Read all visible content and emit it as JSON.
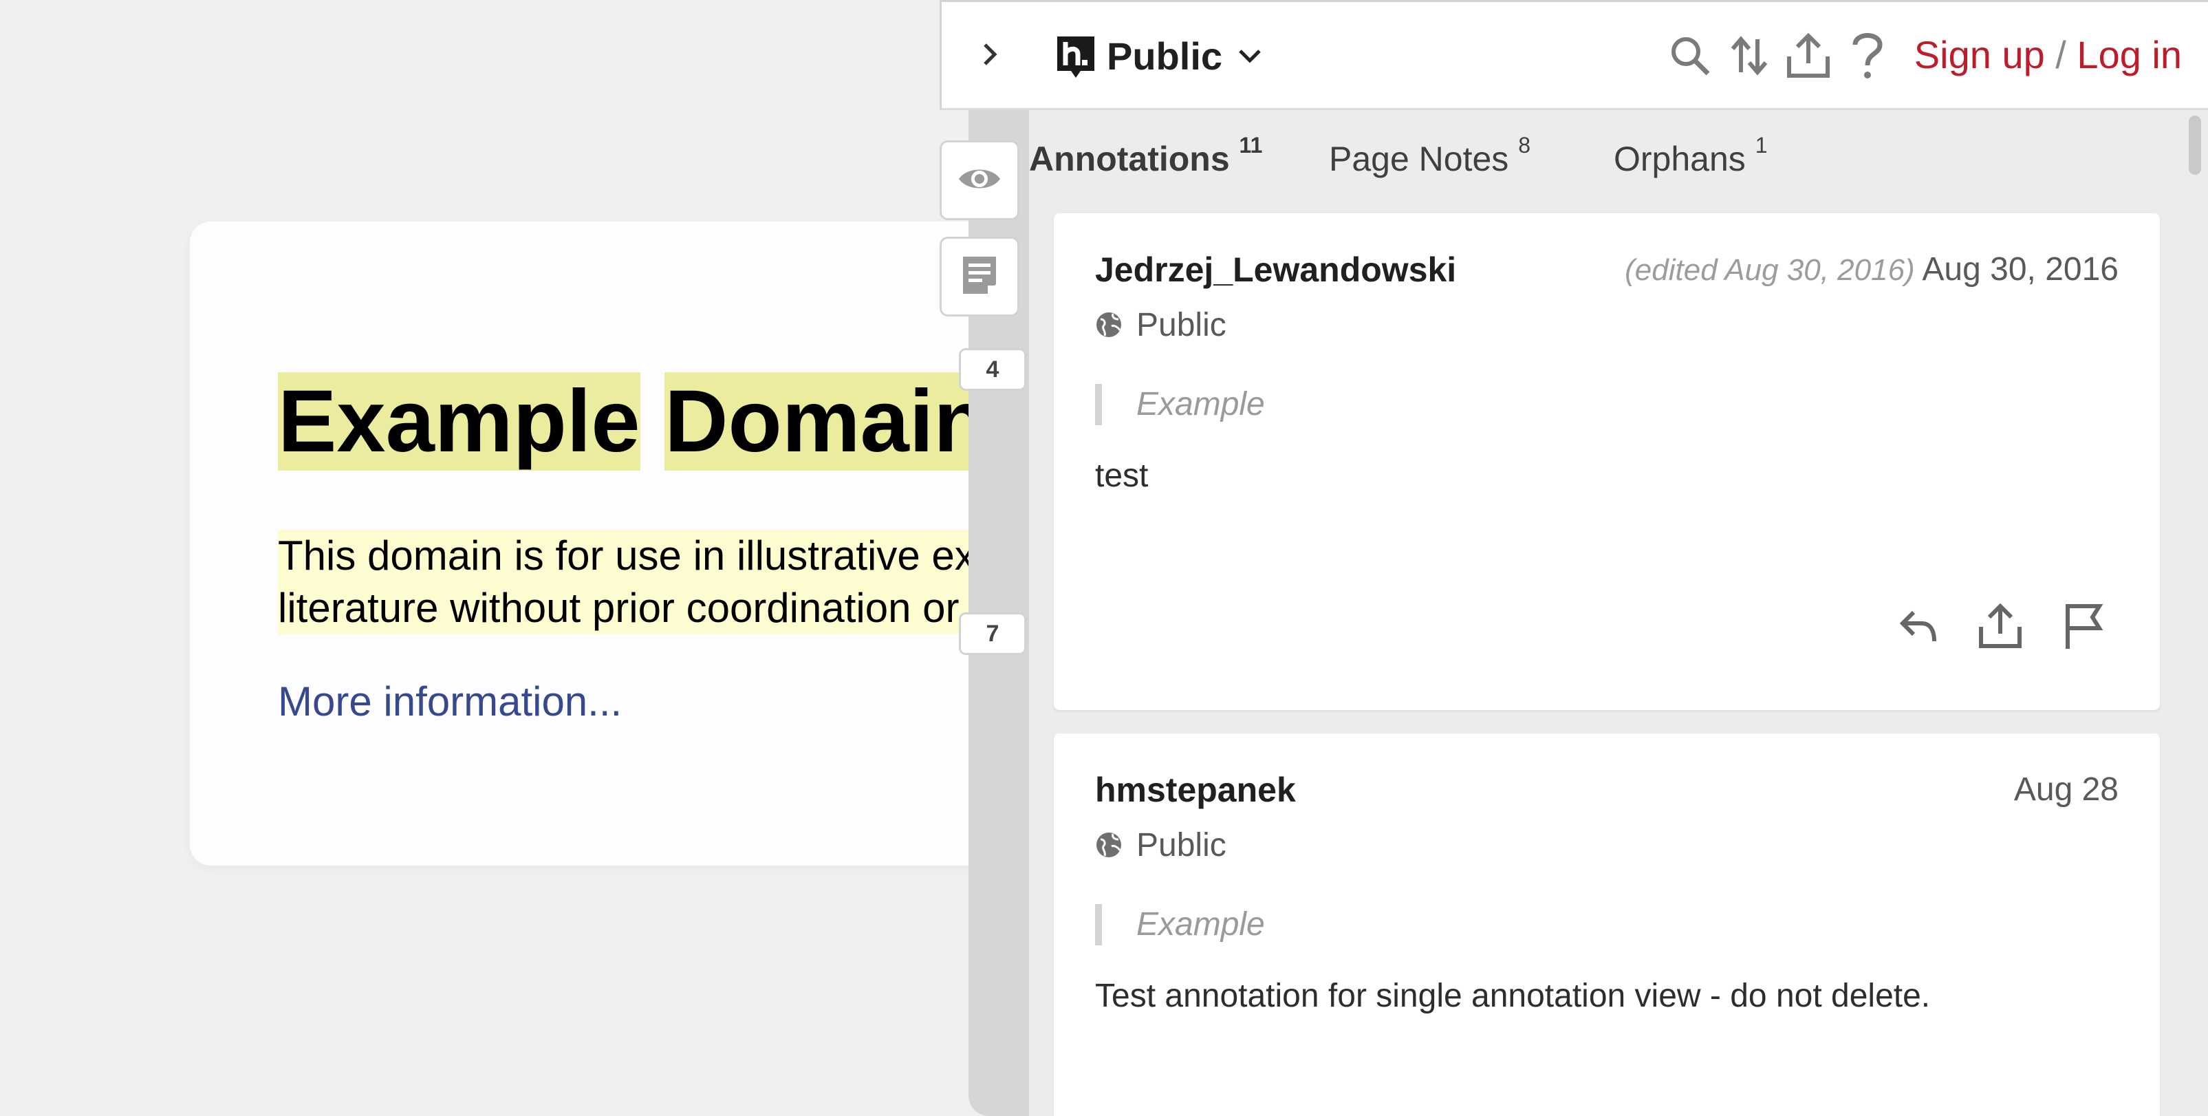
{
  "page": {
    "title_word1": "Example",
    "title_word2": "Domain",
    "para_line1": "This domain is for use in illustrative exam",
    "para_line2": "literature without prior coordination or as",
    "link_text": "More information..."
  },
  "bucket_counts": [
    "4",
    "7"
  ],
  "topbar": {
    "group_name": "Public",
    "sign_up": "Sign up",
    "separator": "/",
    "log_in": "Log in"
  },
  "tabs": [
    {
      "label": "Annotations",
      "count": "11"
    },
    {
      "label": "Page Notes",
      "count": "8"
    },
    {
      "label": "Orphans",
      "count": "1"
    }
  ],
  "annotations": [
    {
      "user": "Jedrzej_Lewandowski",
      "edited": "(edited Aug 30, 2016)",
      "date": "Aug 30, 2016",
      "privacy": "Public",
      "quote": "Example",
      "text": "test"
    },
    {
      "user": "hmstepanek",
      "edited": "",
      "date": "Aug 28",
      "privacy": "Public",
      "quote": "Example",
      "text": "Test annotation for single annotation view - do not delete."
    }
  ],
  "colors": {
    "accent": "#bd1c2b",
    "highlight_strong": "#ecec9f",
    "highlight_light": "#fdfbd0",
    "link": "#38488f"
  },
  "icons": [
    "chevron-right-icon",
    "hypothesis-logo-icon",
    "chevron-down-icon",
    "search-icon",
    "sort-icon",
    "share-icon",
    "help-icon",
    "eye-icon",
    "page-notes-icon",
    "globe-icon",
    "reply-icon",
    "flag-icon"
  ]
}
